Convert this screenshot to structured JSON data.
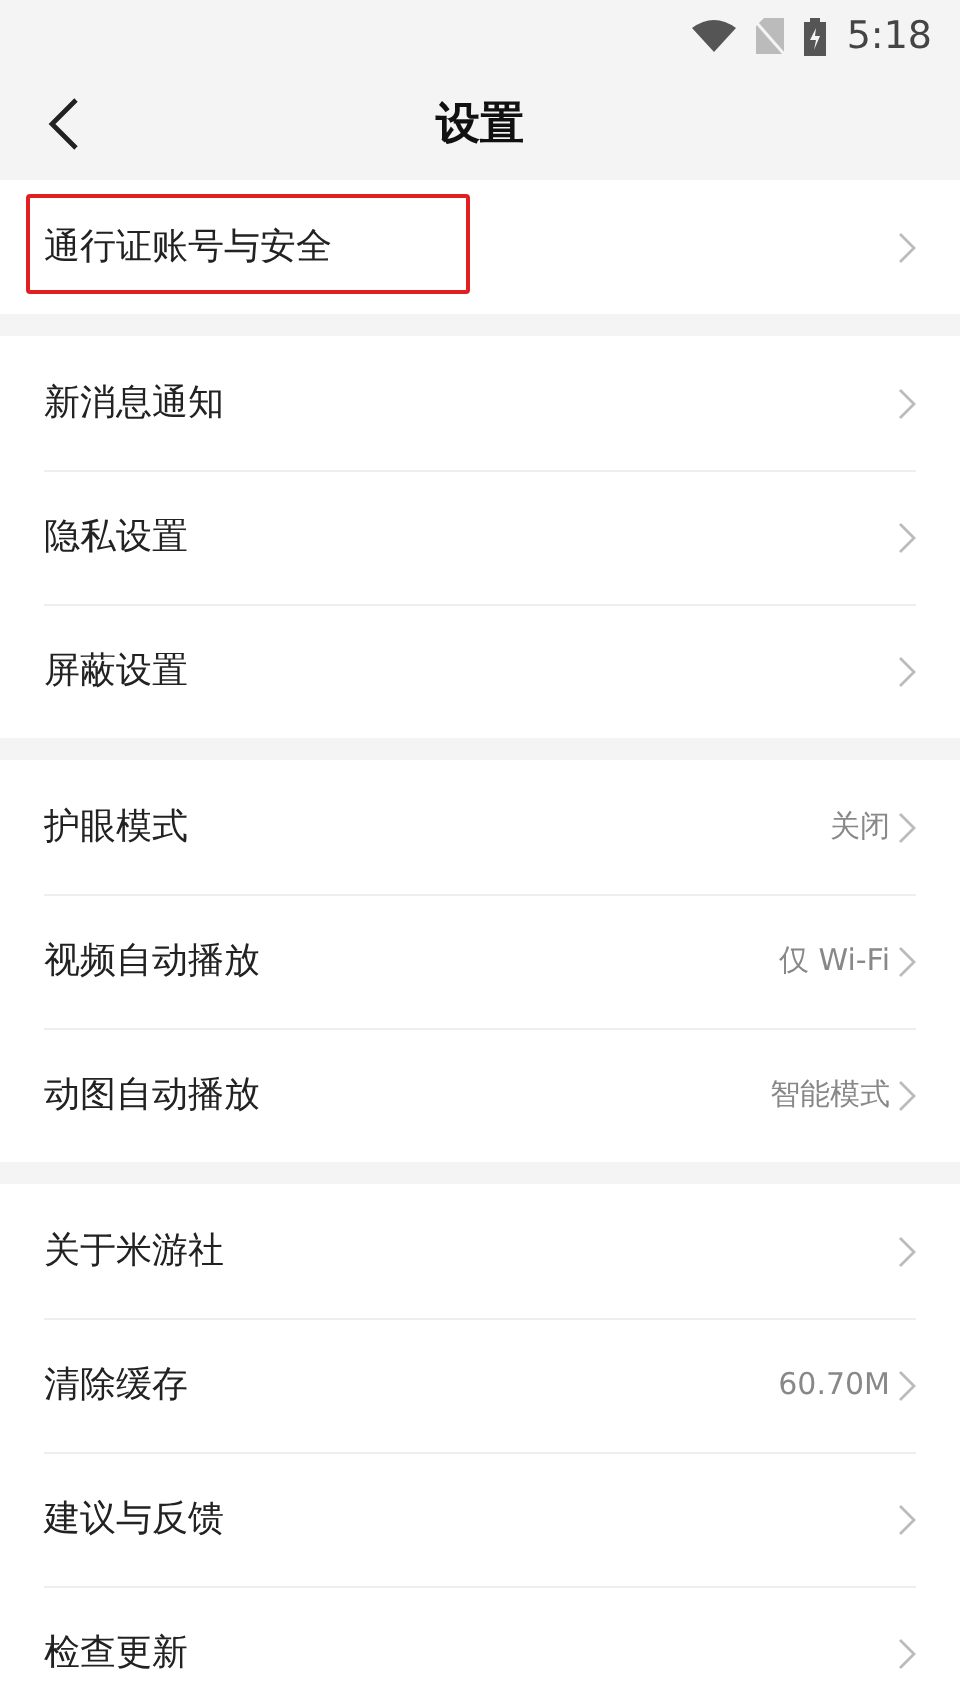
{
  "status_bar": {
    "time": "5:18"
  },
  "header": {
    "title": "设置"
  },
  "groups": [
    {
      "items": [
        {
          "label": "通行证账号与安全",
          "highlighted": true
        }
      ]
    },
    {
      "items": [
        {
          "label": "新消息通知",
          "highlighted": false
        },
        {
          "label": "隐私设置",
          "highlighted": false
        },
        {
          "label": "屏蔽设置",
          "highlighted": false
        }
      ]
    },
    {
      "items": [
        {
          "label": "护眼模式",
          "value": "关闭",
          "highlighted": false
        },
        {
          "label": "视频自动播放",
          "value": "仅 Wi-Fi",
          "highlighted": false
        },
        {
          "label": "动图自动播放",
          "value": "智能模式",
          "highlighted": false
        }
      ]
    },
    {
      "items": [
        {
          "label": "关于米游社",
          "highlighted": false
        },
        {
          "label": "清除缓存",
          "value": "60.70M",
          "highlighted": false
        },
        {
          "label": "建议与反馈",
          "highlighted": false
        },
        {
          "label": "检查更新",
          "highlighted": false
        }
      ]
    }
  ]
}
